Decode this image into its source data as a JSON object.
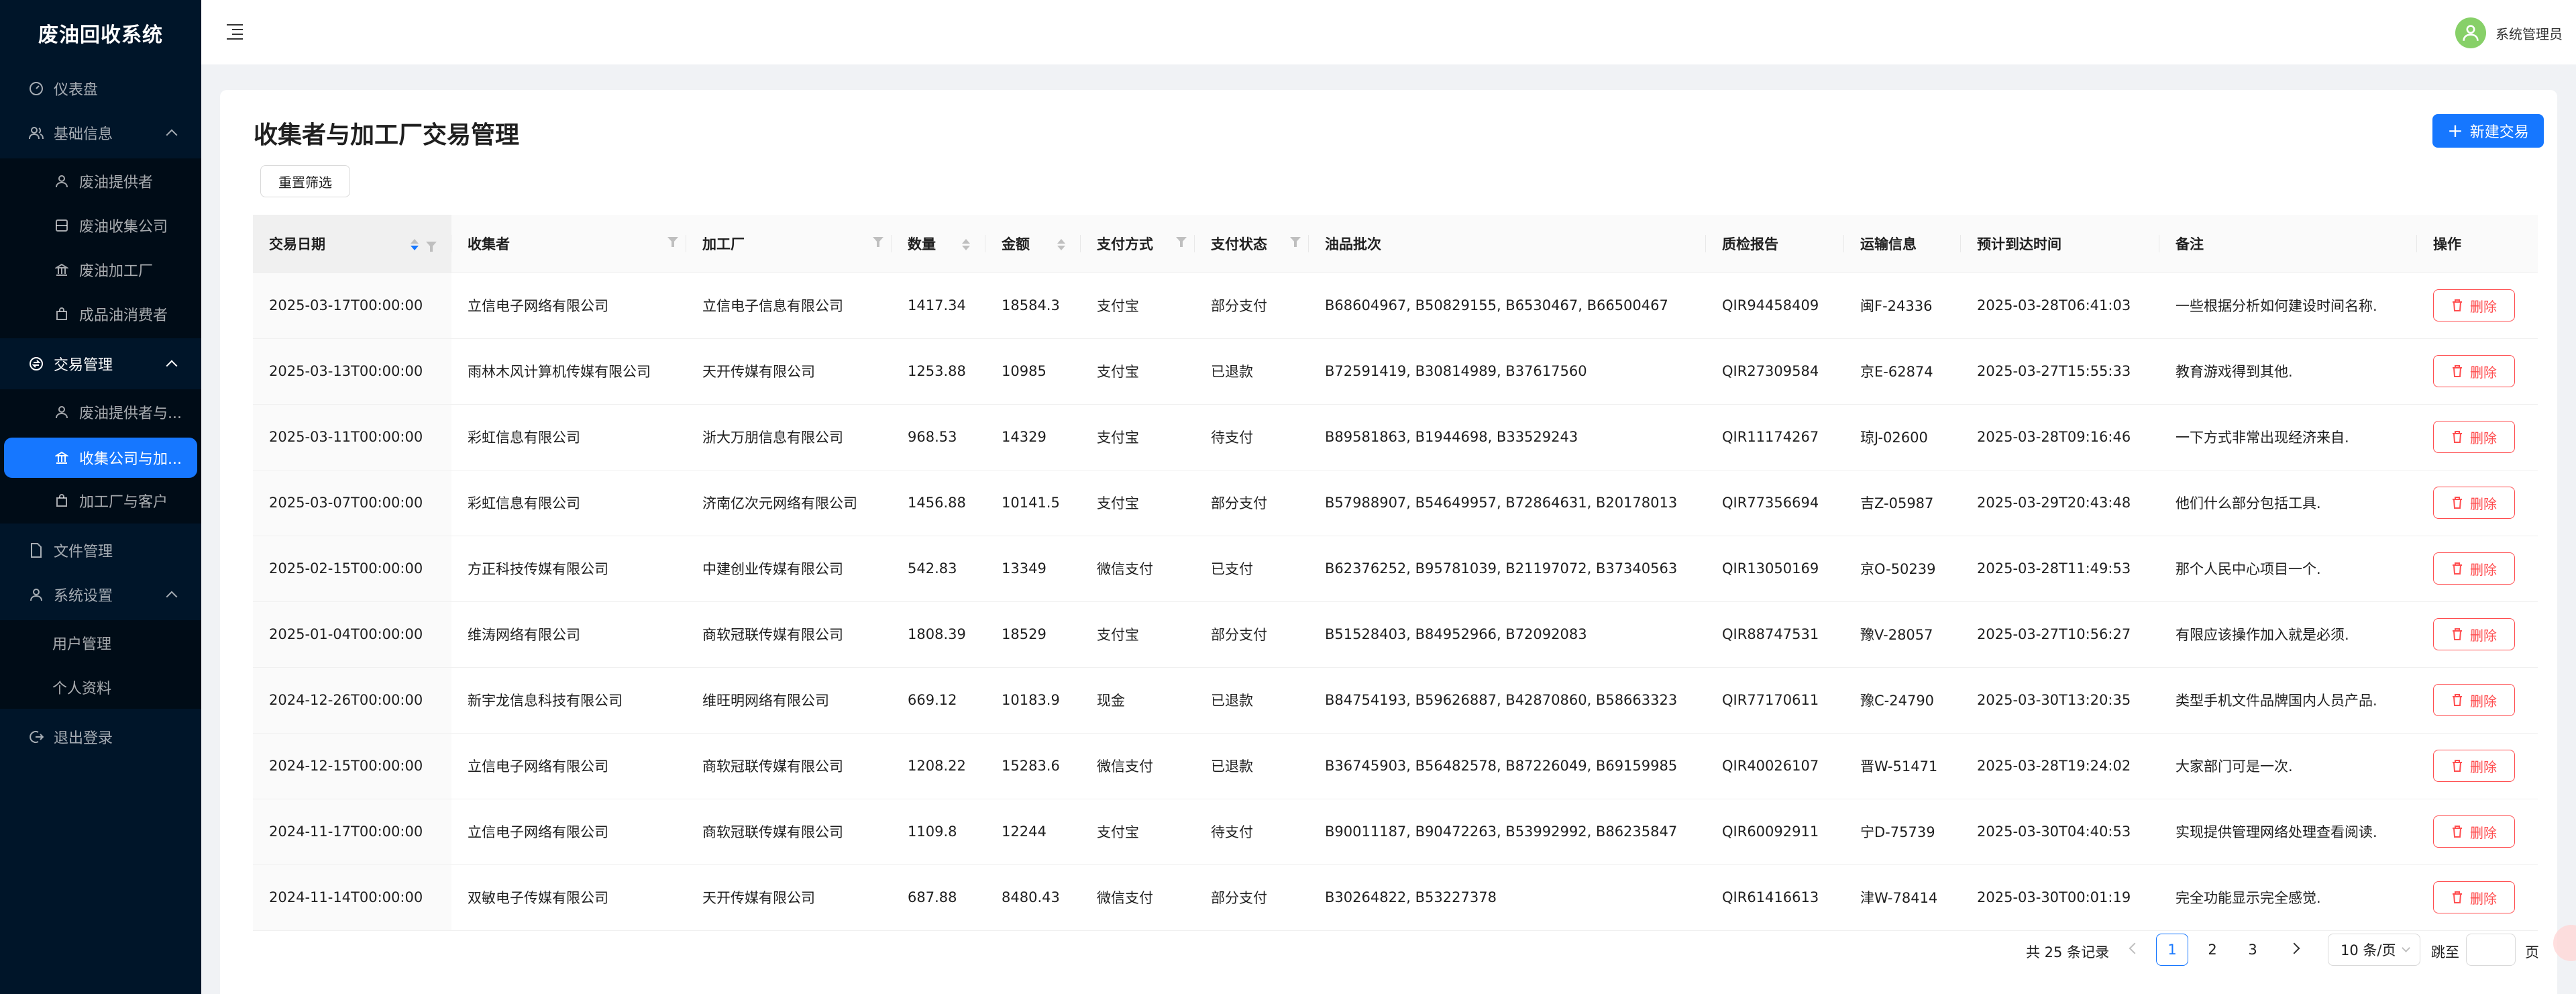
{
  "app": {
    "title": "废油回收系统"
  },
  "sidebar": {
    "dashboard": "仪表盘",
    "basic_info": "基础信息",
    "basic_items": [
      "废油提供者",
      "废油收集公司",
      "废油加工厂",
      "成品油消费者"
    ],
    "trade_mgmt": "交易管理",
    "trade_items": [
      "废油提供者与...",
      "收集公司与加...",
      "加工厂与客户"
    ],
    "file_mgmt": "文件管理",
    "system_settings": "系统设置",
    "system_items": [
      "用户管理",
      "个人资料"
    ],
    "logout": "退出登录"
  },
  "header": {
    "username": "系统管理员"
  },
  "page": {
    "title": "收集者与加工厂交易管理",
    "new_button": "新建交易",
    "reset_button": "重置筛选"
  },
  "table": {
    "columns": [
      "交易日期",
      "收集者",
      "加工厂",
      "数量",
      "金额",
      "支付方式",
      "支付状态",
      "油品批次",
      "质检报告",
      "运输信息",
      "预计到达时间",
      "备注",
      "操作"
    ],
    "delete_label": "删除",
    "rows": [
      [
        "2025-03-17T00:00:00",
        "立信电子网络有限公司",
        "立信电子信息有限公司",
        "1417.34",
        "18584.3",
        "支付宝",
        "部分支付",
        "B68604967, B50829155, B6530467, B66500467",
        "QIR94458409",
        "闽F-24336",
        "2025-03-28T06:41:03",
        "一些根据分析如何建设时间名称."
      ],
      [
        "2025-03-13T00:00:00",
        "雨林木风计算机传媒有限公司",
        "天开传媒有限公司",
        "1253.88",
        "10985",
        "支付宝",
        "已退款",
        "B72591419, B30814989, B37617560",
        "QIR27309584",
        "京E-62874",
        "2025-03-27T15:55:33",
        "教育游戏得到其他."
      ],
      [
        "2025-03-11T00:00:00",
        "彩虹信息有限公司",
        "浙大万朋信息有限公司",
        "968.53",
        "14329",
        "支付宝",
        "待支付",
        "B89581863, B1944698, B33529243",
        "QIR11174267",
        "琼J-02600",
        "2025-03-28T09:16:46",
        "一下方式非常出现经济来自."
      ],
      [
        "2025-03-07T00:00:00",
        "彩虹信息有限公司",
        "济南亿次元网络有限公司",
        "1456.88",
        "10141.5",
        "支付宝",
        "部分支付",
        "B57988907, B54649957, B72864631, B20178013",
        "QIR77356694",
        "吉Z-05987",
        "2025-03-29T20:43:48",
        "他们什么部分包括工具."
      ],
      [
        "2025-02-15T00:00:00",
        "方正科技传媒有限公司",
        "中建创业传媒有限公司",
        "542.83",
        "13349",
        "微信支付",
        "已支付",
        "B62376252, B95781039, B21197072, B37340563",
        "QIR13050169",
        "京O-50239",
        "2025-03-28T11:49:53",
        "那个人民中心项目一个."
      ],
      [
        "2025-01-04T00:00:00",
        "维涛网络有限公司",
        "商软冠联传媒有限公司",
        "1808.39",
        "18529",
        "支付宝",
        "部分支付",
        "B51528403, B84952966, B72092083",
        "QIR88747531",
        "豫V-28057",
        "2025-03-27T10:56:27",
        "有限应该操作加入就是必须."
      ],
      [
        "2024-12-26T00:00:00",
        "新宇龙信息科技有限公司",
        "维旺明网络有限公司",
        "669.12",
        "10183.9",
        "现金",
        "已退款",
        "B84754193, B59626887, B42870860, B58663323",
        "QIR77170611",
        "豫C-24790",
        "2025-03-30T13:20:35",
        "类型手机文件品牌国内人员产品."
      ],
      [
        "2024-12-15T00:00:00",
        "立信电子网络有限公司",
        "商软冠联传媒有限公司",
        "1208.22",
        "15283.6",
        "微信支付",
        "已退款",
        "B36745903, B56482578, B87226049, B69159985",
        "QIR40026107",
        "晋W-51471",
        "2025-03-28T19:24:02",
        "大家部门可是一次."
      ],
      [
        "2024-11-17T00:00:00",
        "立信电子网络有限公司",
        "商软冠联传媒有限公司",
        "1109.8",
        "12244",
        "支付宝",
        "待支付",
        "B90011187, B90472263, B53992992, B86235847",
        "QIR60092911",
        "宁D-75739",
        "2025-03-30T04:40:53",
        "实现提供管理网络处理查看阅读."
      ],
      [
        "2024-11-14T00:00:00",
        "双敏电子传媒有限公司",
        "天开传媒有限公司",
        "687.88",
        "8480.43",
        "微信支付",
        "部分支付",
        "B30264822, B53227378",
        "QIR61416613",
        "津W-78414",
        "2025-03-30T00:01:19",
        "完全功能显示完全感觉."
      ]
    ]
  },
  "pagination": {
    "total": "共 25 条记录",
    "pages": [
      "1",
      "2",
      "3"
    ],
    "current": "1",
    "page_size": "10 条/页",
    "jump_label": "跳至",
    "page_unit": "页"
  },
  "colors": {
    "primary": "#1677ff",
    "danger": "#ff4d4f",
    "sider": "#001529",
    "avatar": "#87d068"
  }
}
